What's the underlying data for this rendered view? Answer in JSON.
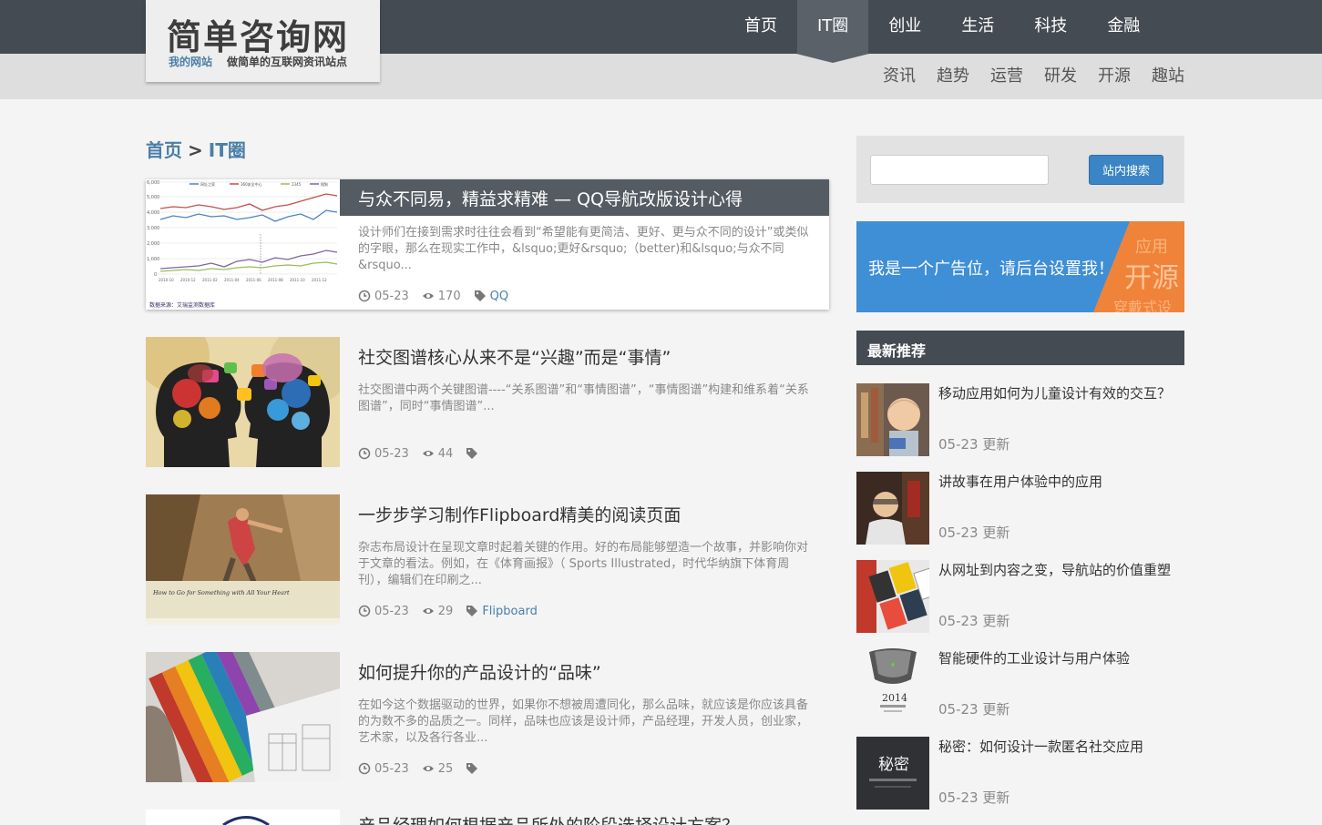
{
  "header": {
    "logo_title": "简单咨询网",
    "logo_site": "我的网站",
    "logo_slogan": "做简单的互联网资讯站点"
  },
  "main_nav": [
    {
      "label": "首页"
    },
    {
      "label": "IT圈",
      "active": true
    },
    {
      "label": "创业"
    },
    {
      "label": "生活"
    },
    {
      "label": "科技"
    },
    {
      "label": "金融"
    }
  ],
  "sub_nav": [
    {
      "label": "资讯"
    },
    {
      "label": "趋势"
    },
    {
      "label": "运营"
    },
    {
      "label": "研发"
    },
    {
      "label": "开源"
    },
    {
      "label": "趣站"
    }
  ],
  "breadcrumb": {
    "home": "首页",
    "separator": ">",
    "current": "IT圈"
  },
  "articles": [
    {
      "title": "与众不同易，精益求精难 — QQ导航改版设计心得",
      "excerpt": "设计师们在接到需求时往往会看到“希望能有更简洁、更好、更与众不同的设计”或类似的字眼，那么在现实工作中，&lsquo;更好&rsquo;（better)和&lsquo;与众不同&rsquo...",
      "date": "05-23",
      "views": "170",
      "tag": "QQ",
      "thumb_caption": "数据来源：艾瑞监测数据库",
      "thumb_legend": [
        "网址之家",
        "360安全中心",
        "2345",
        "搜狗"
      ]
    },
    {
      "title": "社交图谱核心从来不是“兴趣”而是“事情”",
      "excerpt": "社交图谱中两个关键图谱----“关系图谱”和“事情图谱”，“事情图谱”构建和维系着“关系图谱”，同时“事情图谱”...",
      "date": "05-23",
      "views": "44",
      "tag": ""
    },
    {
      "title": "一步步学习制作Flipboard精美的阅读页面",
      "excerpt": "杂志布局设计在呈现文章时起着关键的作用。好的布局能够塑造一个故事，并影响你对于文章的看法。例如，在《体育画报》（ Sports Illustrated，时代华纳旗下体育周刊），编辑们在印刷之...",
      "date": "05-23",
      "views": "29",
      "tag": "Flipboard",
      "thumb_caption": "How to Go for Something with All Your Heart"
    },
    {
      "title": "如何提升你的产品设计的“品味”",
      "excerpt": "在如今这个数据驱动的世界，如果你不想被周遭同化，那么品味，就应该是你应该具备的为数不多的品质之一。同样，品味也应该是设计师，产品经理，开发人员，创业家，艺术家，以及各行各业...",
      "date": "05-23",
      "views": "25",
      "tag": ""
    }
  ],
  "partial_article_title": "产品经理如何根据产品所处的阶段选择设计方案？",
  "sidebar": {
    "search_placeholder": "",
    "search_button": "站内搜索",
    "ad_text": "我是一个广告位，请后台设置我！",
    "ad_art_words": [
      "应用",
      "开源",
      "穿戴式设"
    ],
    "recommend_title": "最新推荐",
    "recommend": [
      {
        "title": "移动应用如何为儿童设计有效的交互？",
        "date": "05-23 更新"
      },
      {
        "title": "讲故事在用户体验中的应用",
        "date": "05-23 更新"
      },
      {
        "title": "从网址到内容之变，导航站的价值重塑",
        "date": "05-23 更新"
      },
      {
        "title": "智能硬件的工业设计与用户体验",
        "date": "05-23 更新",
        "thumb_text": "2014"
      },
      {
        "title": "秘密：如何设计一款匿名社交应用",
        "date": "05-23 更新",
        "thumb_text": "秘密"
      }
    ]
  },
  "colors": {
    "topbar": "#444b52",
    "active_nav": "#5a6168",
    "link_blue": "#4a7fa8",
    "search_button": "#3b85c6",
    "ad_blue": "#3f8fd6",
    "ad_orange": "#f0833a"
  },
  "icons": {
    "date": "clock-icon",
    "views": "eye-icon",
    "tag": "tag-icon"
  }
}
